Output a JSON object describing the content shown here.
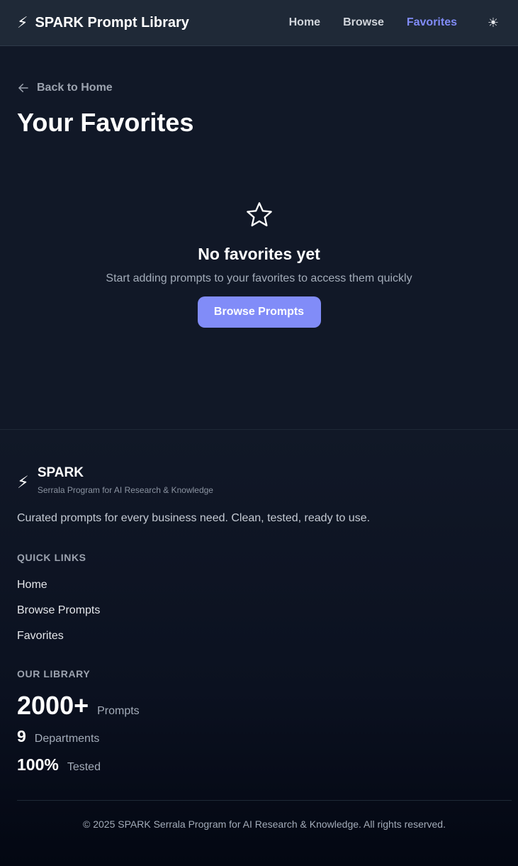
{
  "header": {
    "brand_icon": "lightning-bolt-icon",
    "brand_title": "SPARK Prompt Library",
    "nav": [
      {
        "label": "Home",
        "active": false
      },
      {
        "label": "Browse",
        "active": false
      },
      {
        "label": "Favorites",
        "active": true
      }
    ],
    "theme_toggle_icon": "sun-icon"
  },
  "main": {
    "back_link": "Back to Home",
    "page_title": "Your Favorites",
    "empty_state": {
      "icon": "star-outline-icon",
      "title": "No favorites yet",
      "subtitle": "Start adding prompts to your favorites to access them quickly",
      "button_label": "Browse Prompts"
    }
  },
  "footer": {
    "brand_name": "SPARK",
    "brand_tagline": "Serrala Program for AI Research & Knowledge",
    "description": "Curated prompts for every business need. Clean, tested, ready to use.",
    "quick_links_heading": "QUICK LINKS",
    "quick_links": [
      "Home",
      "Browse Prompts",
      "Favorites"
    ],
    "library_heading": "OUR LIBRARY",
    "stats": [
      {
        "value": "2000+",
        "label": "Prompts"
      },
      {
        "value": "9",
        "label": "Departments"
      },
      {
        "value": "100%",
        "label": "Tested"
      }
    ],
    "copyright": "© 2025 SPARK Serrala Program for AI Research & Knowledge. All rights reserved."
  },
  "colors": {
    "accent": "#818cf8",
    "header_bg": "#1f2937",
    "page_bg": "#111827"
  }
}
